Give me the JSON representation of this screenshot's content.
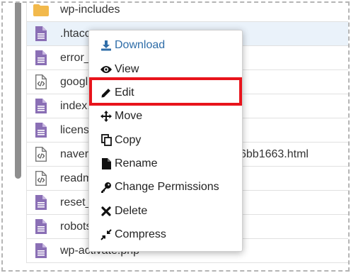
{
  "colors": {
    "folder": "#f2b94c",
    "file_icon": "#8a6fb5",
    "download_accent": "#2f6da8",
    "highlight": "#e8141c",
    "selected_row": "#eaf2fa"
  },
  "files": [
    {
      "name": "wp-includes",
      "icon": "folder-icon"
    },
    {
      "name": ".htacc",
      "icon": "file-icon",
      "selected": true
    },
    {
      "name": "error_",
      "icon": "file-icon"
    },
    {
      "name": "googl",
      "icon": "code-file-icon"
    },
    {
      "name": "index.",
      "icon": "file-icon"
    },
    {
      "name": "licens",
      "icon": "file-icon"
    },
    {
      "name": "naver",
      "icon": "code-file-icon",
      "suffix": "6bb1663.html"
    },
    {
      "name": "readm",
      "icon": "code-file-icon"
    },
    {
      "name": "reset_",
      "icon": "file-icon"
    },
    {
      "name": "robots",
      "icon": "file-icon"
    },
    {
      "name": "wp-activate.php",
      "icon": "file-icon"
    }
  ],
  "context_menu": {
    "items": [
      {
        "label": "Download",
        "icon": "download-icon"
      },
      {
        "label": "View",
        "icon": "eye-icon"
      },
      {
        "label": "Edit",
        "icon": "pencil-icon"
      },
      {
        "label": "Move",
        "icon": "move-arrows-icon"
      },
      {
        "label": "Copy",
        "icon": "copy-icon"
      },
      {
        "label": "Rename",
        "icon": "file-icon"
      },
      {
        "label": "Change Permissions",
        "icon": "key-icon"
      },
      {
        "label": "Delete",
        "icon": "x-icon"
      },
      {
        "label": "Compress",
        "icon": "compress-icon"
      }
    ]
  }
}
